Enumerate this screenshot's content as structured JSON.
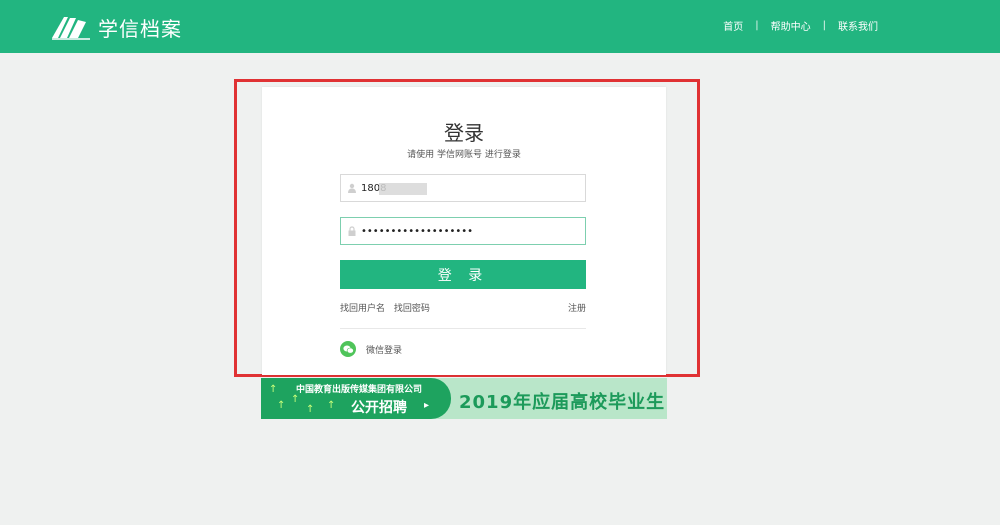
{
  "header": {
    "logo_text": "学信档案",
    "nav": [
      "首页",
      "帮助中心",
      "联系我们"
    ],
    "separator": "|"
  },
  "login": {
    "title": "登录",
    "subtitle": "请使用 学信网账号 进行登录",
    "username_value": "1808",
    "password_value": "•••••••••••••••••••",
    "submit_label": "登 录",
    "find_username": "找回用户名",
    "find_password": "找回密码",
    "register": "注册",
    "wechat_login": "微信登录"
  },
  "banner": {
    "company": "中国教育出版传媒集团有限公司",
    "recruit": "公开招聘",
    "graduates": "2019年应届高校毕业生"
  },
  "colors": {
    "brand": "#22b580",
    "highlight": "#e03234",
    "wechat": "#4fc45a"
  }
}
